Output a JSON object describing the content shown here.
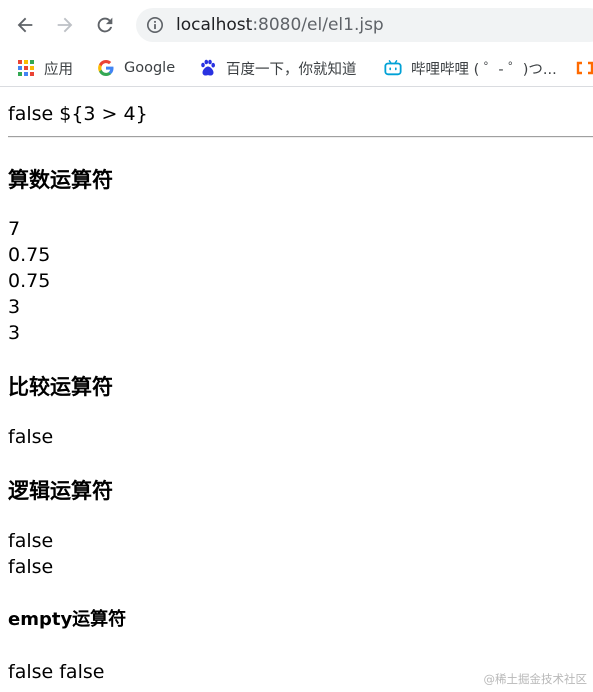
{
  "browser": {
    "url_host": "localhost",
    "url_path": ":8080/el/el1.jsp",
    "bookmarks": [
      {
        "label": "应用",
        "icon": "apps-grid-icon"
      },
      {
        "label": "Google",
        "icon": "google-g-icon"
      },
      {
        "label": "百度一下，你就知道",
        "icon": "baidu-paw-icon"
      },
      {
        "label": "哔哩哔哩 ( ゜- ゜)つ...",
        "icon": "bilibili-tv-icon"
      }
    ]
  },
  "content": {
    "top_line": "false ${3 > 4}",
    "arith_heading": "算数运算符",
    "arith_results": [
      "7",
      "0.75",
      "0.75",
      "3",
      "3"
    ],
    "compare_heading": "比较运算符",
    "compare_results": [
      "false"
    ],
    "logic_heading": "逻辑运算符",
    "logic_results": [
      "false",
      "false"
    ],
    "empty_heading": "empty运算符",
    "empty_results": "false false"
  },
  "watermark": "@稀土掘金技术社区",
  "colors": {
    "chrome_bg": "#ffffff",
    "omnibox_bg": "#f1f3f4",
    "icon_gray": "#5f6368",
    "bilibili_blue": "#00a1d6",
    "baidu_blue": "#2932e1"
  }
}
